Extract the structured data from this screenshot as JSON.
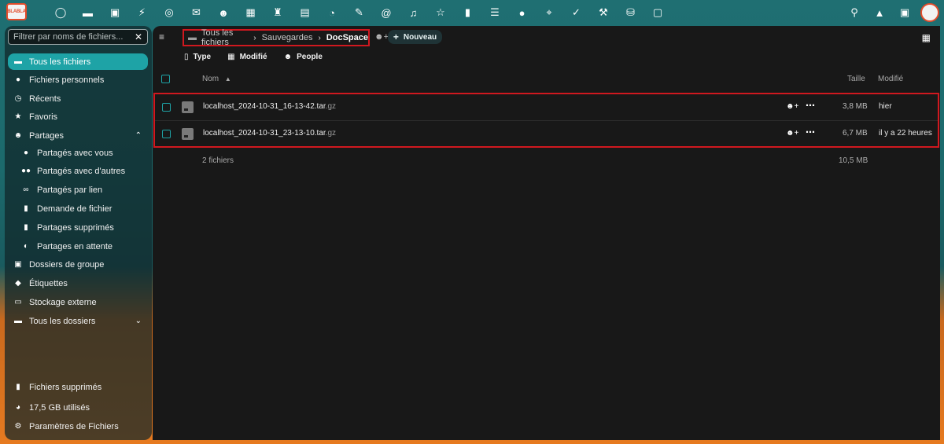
{
  "topbar": {
    "logo_text": "BLABLA",
    "apps": [
      "dashboard-icon",
      "files-icon",
      "photos-icon",
      "activity-icon",
      "talk-icon",
      "mail-icon",
      "contacts-icon",
      "calendar-icon",
      "deck-icon",
      "forms-icon",
      "analytics-icon",
      "notes-icon",
      "mastodon-icon",
      "music-icon",
      "starred-icon",
      "stats-icon",
      "tasks-icon",
      "maps-icon",
      "location-icon",
      "checklist-icon",
      "cookbook-icon",
      "money-icon",
      "news-icon"
    ],
    "right": [
      "search-icon",
      "notifications-icon",
      "contacts-menu-icon"
    ]
  },
  "sidebar": {
    "filter_placeholder": "Filtrer par noms de fichiers...",
    "items": [
      {
        "label": "Tous les fichiers",
        "icon": "folder-icon"
      },
      {
        "label": "Fichiers personnels",
        "icon": "user-icon"
      },
      {
        "label": "Récents",
        "icon": "history-icon"
      },
      {
        "label": "Favoris",
        "icon": "star-icon"
      },
      {
        "label": "Partages",
        "icon": "share-icon"
      },
      {
        "label": "Partagés avec vous",
        "icon": "user-icon"
      },
      {
        "label": "Partagés avec d'autres",
        "icon": "group-icon"
      },
      {
        "label": "Partagés par lien",
        "icon": "link-icon"
      },
      {
        "label": "Demande de fichier",
        "icon": "file-request-icon"
      },
      {
        "label": "Partages supprimés",
        "icon": "trash-icon"
      },
      {
        "label": "Partages en attente",
        "icon": "pending-icon"
      },
      {
        "label": "Dossiers de groupe",
        "icon": "group-folder-icon"
      },
      {
        "label": "Étiquettes",
        "icon": "tag-icon"
      },
      {
        "label": "Stockage externe",
        "icon": "external-storage-icon"
      },
      {
        "label": "Tous les dossiers",
        "icon": "folders-icon"
      }
    ],
    "bottom": [
      {
        "label": "Fichiers supprimés",
        "icon": "trash-icon"
      },
      {
        "label": "17,5 GB utilisés",
        "icon": "pie-icon"
      },
      {
        "label": "Paramètres de Fichiers",
        "icon": "gear-icon"
      }
    ]
  },
  "breadcrumb": {
    "items": [
      "Tous les fichiers",
      "Sauvegardes",
      "DocSpace"
    ]
  },
  "new_button": "Nouveau",
  "filters": [
    "Type",
    "Modifié",
    "People"
  ],
  "table": {
    "headers": {
      "name": "Nom",
      "size": "Taille",
      "modified": "Modifié"
    },
    "rows": [
      {
        "name": "localhost_2024-10-31_16-13-42.tar",
        "ext": ".gz",
        "size": "3,8 MB",
        "modified": "hier"
      },
      {
        "name": "localhost_2024-10-31_23-13-10.tar",
        "ext": ".gz",
        "size": "6,7 MB",
        "modified": "il y a 22 heures"
      }
    ],
    "summary": {
      "count": "2 fichiers",
      "total": "10,5 MB"
    }
  }
}
